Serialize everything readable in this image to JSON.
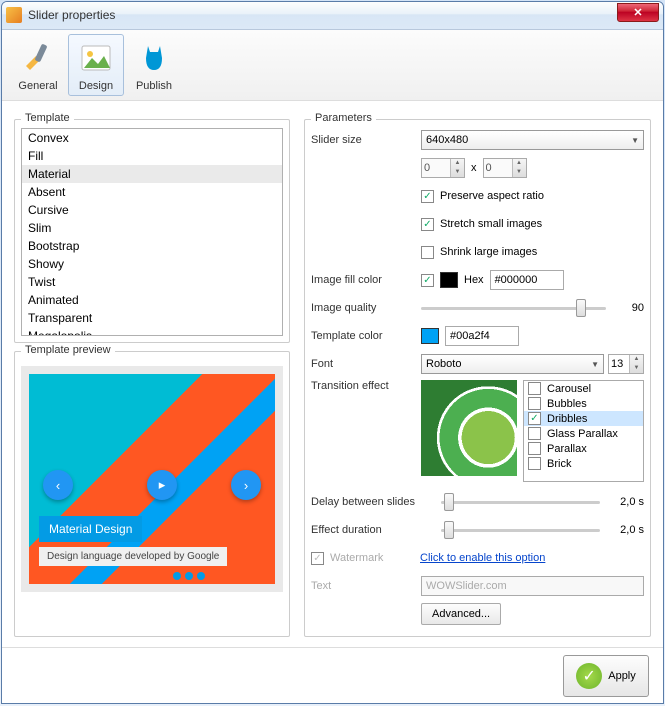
{
  "window": {
    "title": "Slider properties"
  },
  "toolbar": {
    "tabs": [
      {
        "label": "General"
      },
      {
        "label": "Design"
      },
      {
        "label": "Publish"
      }
    ],
    "active": 1
  },
  "template": {
    "label": "Template",
    "items": [
      "Convex",
      "Fill",
      "Material",
      "Absent",
      "Cursive",
      "Slim",
      "Bootstrap",
      "Showy",
      "Twist",
      "Animated",
      "Transparent",
      "Megalopolis"
    ],
    "selected": 2,
    "preview_label": "Template preview",
    "preview_title": "Material Design",
    "preview_sub": "Design language developed by Google"
  },
  "params": {
    "label": "Parameters",
    "slider_size": {
      "label": "Slider size",
      "value": "640x480"
    },
    "dim": {
      "w": "0",
      "x": "x",
      "h": "0"
    },
    "preserve": {
      "label": "Preserve aspect ratio",
      "checked": true
    },
    "stretch": {
      "label": "Stretch small images",
      "checked": true
    },
    "shrink": {
      "label": "Shrink large images",
      "checked": false
    },
    "fillcolor": {
      "label": "Image fill color",
      "checked": true,
      "hex_label": "Hex",
      "value": "#000000",
      "swatch": "#000000"
    },
    "quality": {
      "label": "Image quality",
      "value": "90",
      "pct": 90
    },
    "tplcolor": {
      "label": "Template color",
      "value": "#00a2f4",
      "swatch": "#00a2f4"
    },
    "font": {
      "label": "Font",
      "value": "Roboto",
      "size": "13"
    },
    "transition": {
      "label": "Transition effect",
      "items": [
        {
          "label": "Carousel",
          "checked": false
        },
        {
          "label": "Bubbles",
          "checked": false
        },
        {
          "label": "Dribbles",
          "checked": true
        },
        {
          "label": "Glass Parallax",
          "checked": false
        },
        {
          "label": "Parallax",
          "checked": false
        },
        {
          "label": "Brick",
          "checked": false
        }
      ],
      "selected": 2
    },
    "delay": {
      "label": "Delay between slides",
      "value": "2,0 s",
      "pct": 3
    },
    "duration": {
      "label": "Effect duration",
      "value": "2,0 s",
      "pct": 3
    },
    "watermark": {
      "label": "Watermark",
      "link": "Click to enable this option"
    },
    "text": {
      "label": "Text",
      "value": "WOWSlider.com"
    },
    "advanced": {
      "label": "Advanced..."
    }
  },
  "footer": {
    "apply": "Apply"
  }
}
